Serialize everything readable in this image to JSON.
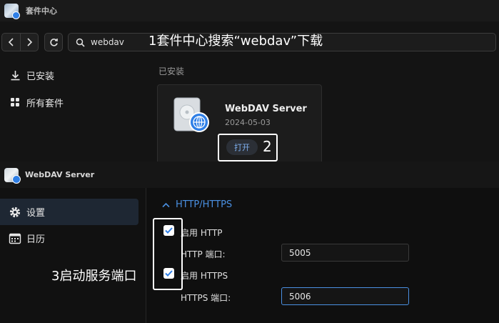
{
  "package_center": {
    "title": "套件中心",
    "search": {
      "value": "webdav",
      "placeholder": ""
    },
    "overlay_instruction": "1套件中心搜索“webdav”下载",
    "sidebar": [
      {
        "label": "已安装",
        "icon": "download-icon"
      },
      {
        "label": "所有套件",
        "icon": "grid-icon"
      }
    ],
    "section_label": "已安装",
    "package": {
      "name": "WebDAV Server",
      "date": "2024-05-03",
      "open_label": "打开"
    },
    "annotation_2": "2"
  },
  "webdav_server": {
    "title": "WebDAV Server",
    "sidebar": [
      {
        "label": "设置",
        "icon": "gear-icon",
        "active": true
      },
      {
        "label": "日历",
        "icon": "calendar-icon",
        "active": false
      }
    ],
    "section_title": "HTTP/HTTPS",
    "enable_http_label": "启用 HTTP",
    "http_port_label": "HTTP 端口:",
    "http_port_value": "5005",
    "enable_https_label": "启用 HTTPS",
    "https_port_label": "HTTPS 端口:",
    "https_port_value": "5006",
    "enable_http_checked": true,
    "enable_https_checked": true,
    "annotation_3": "3启动服务端口"
  },
  "colors": {
    "accent": "#4a90e2",
    "background": "#0c0c0c",
    "annotation": "#ffffff"
  }
}
